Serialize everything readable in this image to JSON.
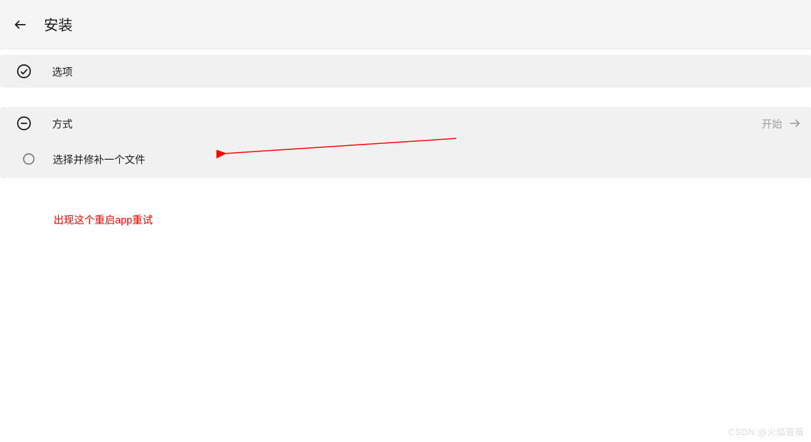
{
  "header": {
    "title": "安装"
  },
  "options": {
    "label": "选项"
  },
  "method": {
    "label": "方式",
    "start": "开始",
    "option_label": "选择并修补一个文件"
  },
  "note": "出现这个重启app重试",
  "watermark": "CSDN @火焰蔷薇"
}
